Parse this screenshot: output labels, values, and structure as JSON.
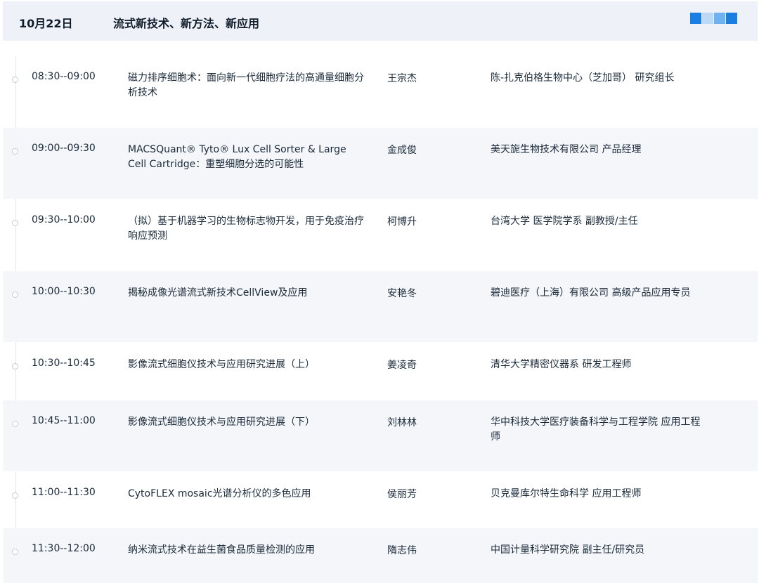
{
  "header": {
    "date": "10月22日",
    "title": "流式新技术、新方法、新应用",
    "toggle_colors": [
      "#1a7fe0",
      "#bcd9f5",
      "#6fb3ee",
      "#1a7fe0"
    ]
  },
  "colors": {
    "header_bg": "#eef2f8",
    "row_alt_bg": "#f4f6f9",
    "timeline_line": "#e2e6ec"
  },
  "sessions": [
    {
      "time": "08:30--09:00",
      "topic": "磁力排序细胞术：面向新一代细胞疗法的高通量细胞分析技术",
      "speaker": "王宗杰",
      "affiliation": "陈-扎克伯格生物中心（芝加哥） 研究组长"
    },
    {
      "time": "09:00--09:30",
      "topic": "MACSQuant® Tyto® Lux Cell Sorter & Large Cell Cartridge：重塑细胞分选的可能性",
      "speaker": "金成俊",
      "affiliation": "美天旎生物技术有限公司 产品经理"
    },
    {
      "time": "09:30--10:00",
      "topic": "（拟）基于机器学习的生物标志物开发，用于免疫治疗响应预测",
      "speaker": "柯博升",
      "affiliation": "台湾大学 医学院学系 副教授/主任"
    },
    {
      "time": "10:00--10:30",
      "topic": "揭秘成像光谱流式新技术CellView及应用",
      "speaker": "安艳冬",
      "affiliation": "碧迪医疗（上海）有限公司 高级产品应用专员"
    },
    {
      "time": "10:30--10:45",
      "topic": "影像流式细胞仪技术与应用研究进展（上）",
      "speaker": "姜凌奇",
      "affiliation": "清华大学精密仪器系 研发工程师"
    },
    {
      "time": "10:45--11:00",
      "topic": "影像流式细胞仪技术与应用研究进展（下）",
      "speaker": "刘林林",
      "affiliation": "华中科技大学医疗装备科学与工程学院 应用工程师"
    },
    {
      "time": "11:00--11:30",
      "topic": "CytoFLEX mosaic光谱分析仪的多色应用",
      "speaker": "侯丽芳",
      "affiliation": "贝克曼库尔特生命科学 应用工程师"
    },
    {
      "time": "11:30--12:00",
      "topic": "纳米流式技术在益生菌食品质量检测的应用",
      "speaker": "隋志伟",
      "affiliation": "中国计量科学研究院 副主任/研究员"
    }
  ]
}
